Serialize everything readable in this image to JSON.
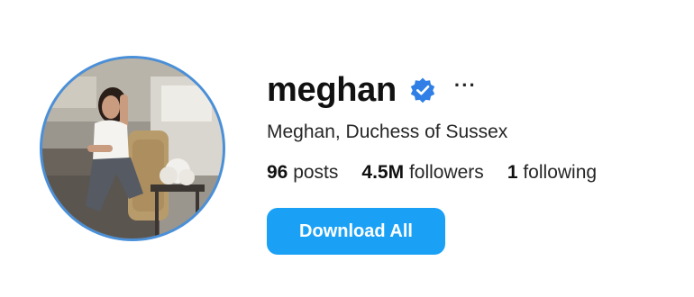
{
  "profile": {
    "username": "meghan",
    "full_name": "Meghan, Duchess of Sussex",
    "verified": true,
    "more_label": "···",
    "avatar_icon": "profile-photo",
    "stats": {
      "posts_count": "96",
      "posts_label": "posts",
      "followers_count": "4.5M",
      "followers_label": "followers",
      "following_count": "1",
      "following_label": "following"
    },
    "download_all_label": "Download All"
  },
  "colors": {
    "accent": "#1aa1f5",
    "verified_badge": "#2f7fe6",
    "avatar_ring": "#4a90d9"
  }
}
